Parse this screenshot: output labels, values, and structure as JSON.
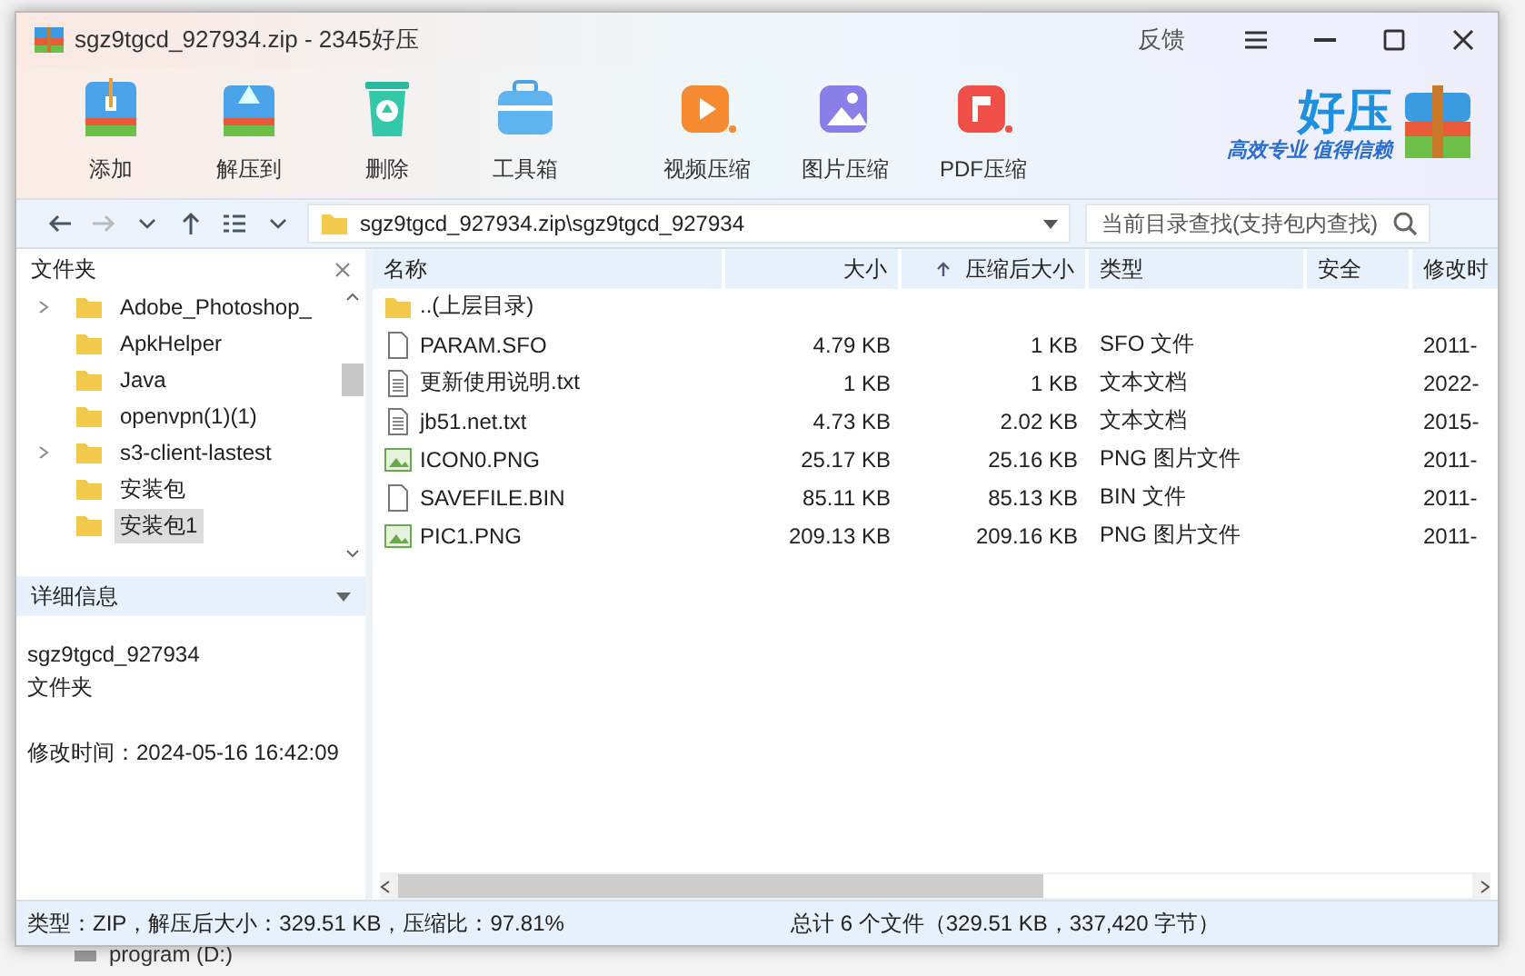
{
  "background": {
    "drive_label": "program (D:)"
  },
  "window": {
    "title": "sgz9tgcd_927934.zip - 2345好压",
    "feedback": "反馈"
  },
  "toolbar": [
    {
      "kind": "add",
      "label": "添加"
    },
    {
      "kind": "extract",
      "label": "解压到"
    },
    {
      "kind": "delete",
      "label": "删除"
    },
    {
      "kind": "toolbox",
      "label": "工具箱"
    },
    {
      "kind": "video",
      "label": "视频压缩"
    },
    {
      "kind": "image",
      "label": "图片压缩"
    },
    {
      "kind": "pdf",
      "label": "PDF压缩"
    }
  ],
  "brand": {
    "name": "好压",
    "slogan": "高效专业 值得信赖"
  },
  "address": {
    "path": "sgz9tgcd_927934.zip\\sgz9tgcd_927934",
    "search_placeholder": "当前目录查找(支持包内查找)"
  },
  "folder_pane": {
    "title": "文件夹",
    "items": [
      {
        "label": "Adobe_Photoshop_",
        "expandable": true,
        "selected": false
      },
      {
        "label": "ApkHelper",
        "expandable": false,
        "selected": false
      },
      {
        "label": "Java",
        "expandable": false,
        "selected": false
      },
      {
        "label": "openvpn(1)(1)",
        "expandable": false,
        "selected": false
      },
      {
        "label": "s3-client-lastest",
        "expandable": true,
        "selected": false
      },
      {
        "label": "安装包",
        "expandable": false,
        "selected": false
      },
      {
        "label": "安装包1",
        "expandable": false,
        "selected": true
      }
    ]
  },
  "details": {
    "title": "详细信息",
    "name": "sgz9tgcd_927934",
    "type": "文件夹",
    "modified": "修改时间：2024-05-16 16:42:09"
  },
  "table": {
    "columns": [
      {
        "label": "名称",
        "sorted": false
      },
      {
        "label": "大小",
        "sorted": false
      },
      {
        "label": "压缩后大小",
        "sorted": true
      },
      {
        "label": "类型",
        "sorted": false
      },
      {
        "label": "安全",
        "sorted": false
      },
      {
        "label": "修改时",
        "sorted": false
      }
    ],
    "rows": [
      {
        "kind": "folder",
        "name": "..(上层目录)"
      },
      {
        "kind": "file",
        "name": "PARAM.SFO",
        "size": "4.79 KB",
        "packed": "1 KB",
        "type": "SFO 文件",
        "modified": "2011-"
      },
      {
        "kind": "text",
        "name": "更新使用说明.txt",
        "size": "1 KB",
        "packed": "1 KB",
        "type": "文本文档",
        "modified": "2022-"
      },
      {
        "kind": "text",
        "name": "jb51.net.txt",
        "size": "4.73 KB",
        "packed": "2.02 KB",
        "type": "文本文档",
        "modified": "2015-"
      },
      {
        "kind": "image",
        "name": "ICON0.PNG",
        "size": "25.17 KB",
        "packed": "25.16 KB",
        "type": "PNG 图片文件",
        "modified": "2011-"
      },
      {
        "kind": "file",
        "name": "SAVEFILE.BIN",
        "size": "85.11 KB",
        "packed": "85.13 KB",
        "type": "BIN 文件",
        "modified": "2011-"
      },
      {
        "kind": "image",
        "name": "PIC1.PNG",
        "size": "209.13 KB",
        "packed": "209.16 KB",
        "type": "PNG 图片文件",
        "modified": "2011-"
      }
    ]
  },
  "status_bar": {
    "left": "类型：ZIP，解压后大小：329.51 KB，压缩比：97.81%",
    "right": "总计 6 个文件（329.51 KB，337,420 字节）"
  }
}
